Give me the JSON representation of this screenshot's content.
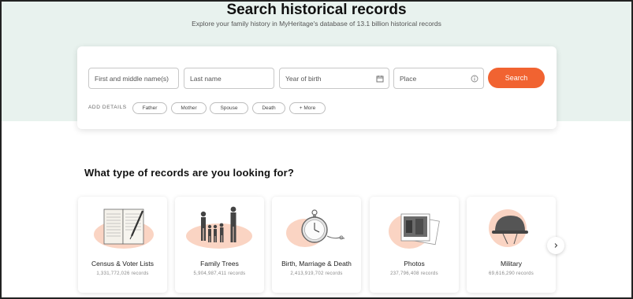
{
  "header": {
    "title": "Search historical records",
    "subtitle": "Explore your family history in MyHeritage's database of 13.1 billion historical records"
  },
  "search": {
    "first_name_placeholder": "First and middle name(s)",
    "last_name_placeholder": "Last name",
    "birth_year_placeholder": "Year of birth",
    "place_placeholder": "Place",
    "button_label": "Search",
    "add_details_label": "ADD DETAILS",
    "chips": [
      "Father",
      "Mother",
      "Spouse",
      "Death",
      "+ More"
    ]
  },
  "categories_section": {
    "title": "What type of records are you looking for?",
    "items": [
      {
        "name": "Census & Voter Lists",
        "count": "1,331,772,026 records",
        "icon": "census-book-icon"
      },
      {
        "name": "Family Trees",
        "count": "5,904,987,411 records",
        "icon": "family-people-icon"
      },
      {
        "name": "Birth, Marriage & Death",
        "count": "2,413,919,702 records",
        "icon": "pocket-watch-icon"
      },
      {
        "name": "Photos",
        "count": "237,796,408 records",
        "icon": "photos-stack-icon"
      },
      {
        "name": "Military",
        "count": "69,616,290 records",
        "icon": "military-helmet-icon"
      }
    ],
    "next_icon": "chevron-right-icon"
  },
  "colors": {
    "hero_bg": "#e8f2ee",
    "accent": "#f16331",
    "blob": "#f9cdb8"
  }
}
